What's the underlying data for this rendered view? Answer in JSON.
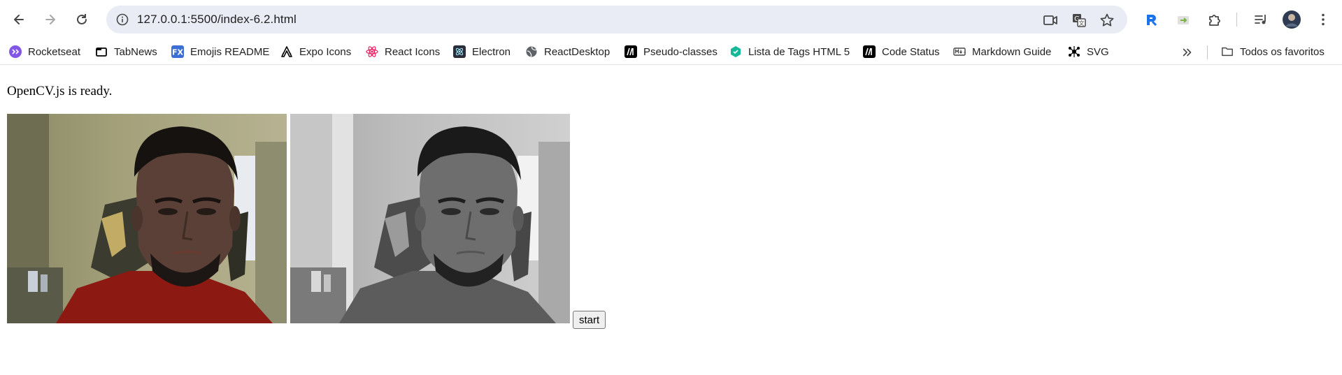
{
  "browser": {
    "url": "127.0.0.1:5500/index-6.2.html",
    "icons": {
      "back": "arrow-left-icon",
      "forward": "arrow-right-icon",
      "reload": "reload-icon",
      "site_info": "info-icon",
      "camera": "camera-icon",
      "translate": "translate-icon",
      "bookmark": "star-icon",
      "extension_1": "extension-blue-icon",
      "extension_2": "extension-green-icon",
      "extensions": "puzzle-icon",
      "media": "media-controls-icon",
      "profile": "avatar",
      "menu": "kebab-menu-icon"
    }
  },
  "bookmarks": {
    "items": [
      {
        "label": "Rocketseat",
        "icon": "rocketseat-icon",
        "color": "#8257e5"
      },
      {
        "label": "TabNews",
        "icon": "tabnews-icon",
        "color": "#000000"
      },
      {
        "label": "Emojis README",
        "icon": "fx-icon",
        "color": "#3b6fd6"
      },
      {
        "label": "Expo Icons",
        "icon": "expo-icon",
        "color": "#000000"
      },
      {
        "label": "React Icons",
        "icon": "react-icon",
        "color": "#e91e63"
      },
      {
        "label": "Electron",
        "icon": "electron-icon",
        "color": "#2b2e3a"
      },
      {
        "label": "ReactDesktop",
        "icon": "globe-icon",
        "color": "#5f6368"
      },
      {
        "label": "Pseudo-classes",
        "icon": "mdn-icon",
        "color": "#000000"
      },
      {
        "label": "Lista de Tags HTML 5",
        "icon": "hexagon-icon",
        "color": "#17b897"
      },
      {
        "label": "Code Status",
        "icon": "mdn-icon",
        "color": "#000000"
      },
      {
        "label": "Markdown Guide",
        "icon": "markdown-icon",
        "color": "#444444"
      },
      {
        "label": "SVG",
        "icon": "svg-icon",
        "color": "#000000"
      }
    ],
    "overflow_icon": "chevron-double-right-icon",
    "all_bookmarks": {
      "label": "Todos os favoritos",
      "icon": "folder-icon"
    }
  },
  "page": {
    "status": "OpenCV.js is ready.",
    "videos": [
      {
        "name": "color-camera-feed"
      },
      {
        "name": "grayscale-camera-feed"
      }
    ],
    "start_button": "start"
  }
}
